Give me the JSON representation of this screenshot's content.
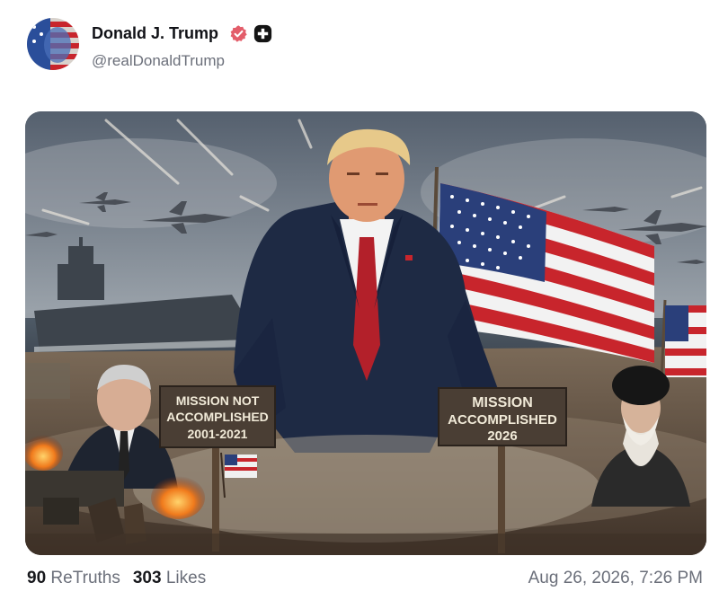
{
  "author": {
    "display_name": "Donald J. Trump",
    "handle": "@realDonaldTrump",
    "verified_icon": "verified-badge-icon",
    "extra_icon": "plus-badge-icon"
  },
  "media": {
    "sign_left": {
      "line1": "MISSION NOT",
      "line2": "ACCOMPLISHED",
      "line3": "2001-2021"
    },
    "sign_right": {
      "line1": "MISSION",
      "line2": "ACCOMPLISHED",
      "line3": "2026"
    }
  },
  "stats": {
    "retruths_count": "90",
    "retruths_label": "ReTruths",
    "likes_count": "303",
    "likes_label": "Likes"
  },
  "timestamp": "Aug 26, 2026, 7:26 PM",
  "colors": {
    "verified": "#e35d6a",
    "text_primary": "#17181c",
    "text_secondary": "#6b6f7a"
  }
}
